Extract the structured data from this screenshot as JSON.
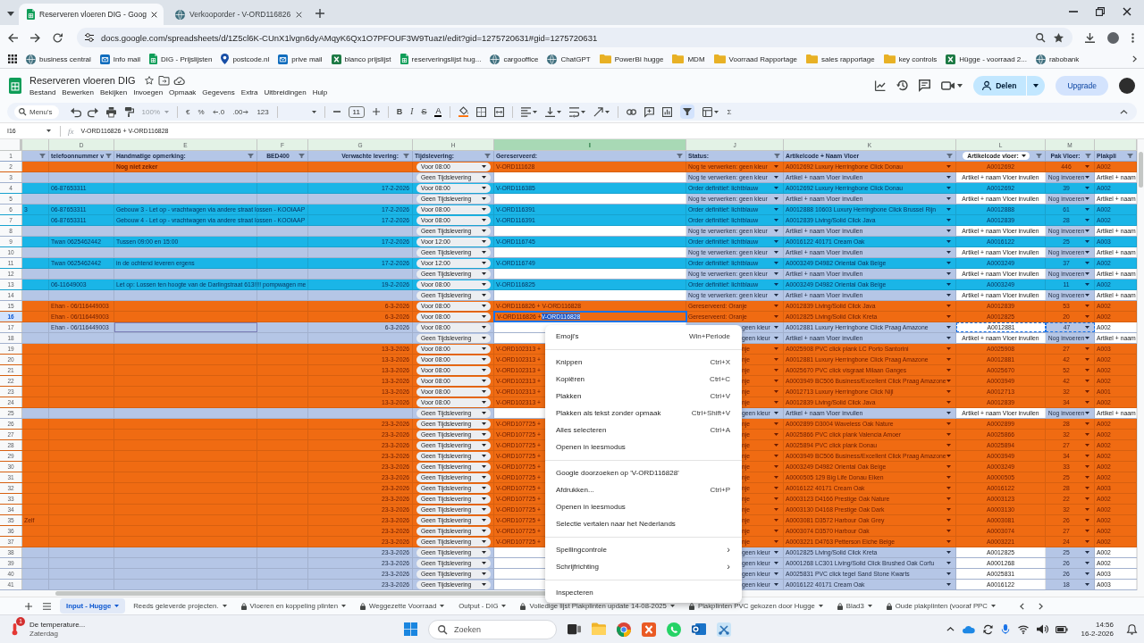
{
  "browser": {
    "tabs": [
      {
        "title": "Reserveren vloeren DIG - Goog",
        "kind": "sheets",
        "selected": true
      },
      {
        "title": "Verkooporder - V-ORD116826",
        "kind": "site",
        "selected": false
      }
    ],
    "url": "docs.google.com/spreadsheets/d/1Z5cl6K-CUnX1lvgn6dyAMqyK6Qx1O7PFOUF3W9TuazI/edit?gid=1275720631#gid=1275720631",
    "bookmarks": [
      {
        "label": "business central",
        "kind": "site"
      },
      {
        "label": "Info mail",
        "kind": "mail"
      },
      {
        "label": "DIG - Prijslijsten",
        "kind": "sheets"
      },
      {
        "label": "postcode.nl",
        "kind": "pin"
      },
      {
        "label": "prive mail",
        "kind": "mail"
      },
      {
        "label": "blanco prijslijst",
        "kind": "excel"
      },
      {
        "label": "reserveringslijst hug...",
        "kind": "sheets"
      },
      {
        "label": "cargooffice",
        "kind": "site"
      },
      {
        "label": "ChatGPT",
        "kind": "site"
      },
      {
        "label": "PowerBI hugge",
        "kind": "folder"
      },
      {
        "label": "MDM",
        "kind": "folder"
      },
      {
        "label": "Voorraad Rapportage",
        "kind": "folder"
      },
      {
        "label": "sales rapportage",
        "kind": "folder"
      },
      {
        "label": "key controls",
        "kind": "folder"
      },
      {
        "label": "Hügge - voorraad 2...",
        "kind": "excel"
      },
      {
        "label": "rabobank",
        "kind": "site"
      }
    ]
  },
  "document": {
    "title": "Reserveren vloeren DIG",
    "menus": [
      "Bestand",
      "Bewerken",
      "Bekijken",
      "Invoegen",
      "Opmaak",
      "Gegevens",
      "Extra",
      "Uitbreidingen",
      "Hulp"
    ],
    "share": "Delen",
    "upgrade": "Upgrade"
  },
  "toolbar": {
    "search": {
      "placeholder": "Menu's"
    },
    "zoom": {
      "value": "100%",
      "disabled": true
    },
    "currency": "€",
    "percent": "%",
    "decimals_less": ".0",
    "decimals_more": ".00",
    "number_format": "123",
    "font_size": "11",
    "bold": "B",
    "italic": "I",
    "strikethrough": "S",
    "text_color": "A",
    "functions": "Σ",
    "filter_on": true
  },
  "formula_bar": {
    "cell": "I16",
    "function_label": "fx",
    "formula": "V-ORD116826 + V-ORD116828"
  },
  "sheet": {
    "header_row": "1",
    "columns": [
      {
        "kind": "text",
        "selected": false
      },
      {
        "letter": "D",
        "header": {
          "text": "telefoonnummer v",
          "kind": "text"
        },
        "kind": "text",
        "selected": false
      },
      {
        "letter": "E",
        "header": {
          "text": "Handmatige opmerking:",
          "kind": "text"
        },
        "kind": "text",
        "selected": false
      },
      {
        "letter": "F",
        "header": {
          "text": "BED400",
          "kind": "text"
        },
        "kind": "text",
        "selected": false
      },
      {
        "letter": "G",
        "header": {
          "text": "Verwachte levering:",
          "kind": "text"
        },
        "kind": "text",
        "selected": false
      },
      {
        "letter": "H",
        "header": {
          "text": "Tijdslevering:",
          "kind": "text"
        },
        "kind": "chip",
        "selected": false
      },
      {
        "letter": "I",
        "header": {
          "text": "Gereserveerd:",
          "kind": "text"
        },
        "kind": "text",
        "selected": true
      },
      {
        "letter": "J",
        "header": {
          "text": "Status:",
          "kind": "text"
        },
        "kind": "dropdown",
        "selected": false
      },
      {
        "letter": "K",
        "header": {
          "text": "Artikelcode + Naam Vloer",
          "kind": "text"
        },
        "kind": "dropdown",
        "selected": false
      },
      {
        "letter": "L",
        "header": {
          "text": "Artikelcode vloer:",
          "kind": "chip"
        },
        "kind": "text",
        "selected": false
      },
      {
        "letter": "M",
        "header": {
          "text": "Pak Vloer:",
          "kind": "text"
        },
        "kind": "dropdown",
        "selected": false
      },
      {
        "header": {
          "text": "Plakpli",
          "kind": "text"
        },
        "kind": "text",
        "selected": false
      }
    ],
    "rows": [
      {
        "row": "2",
        "kind": "reserved",
        "selected": false,
        "cells": [
          null,
          null,
          {
            "text": "Nog niet zeker",
            "kind": "bold"
          },
          null,
          null,
          "Voor 08:00",
          "V-ORD111628",
          "Nog te verwerken: geen kleur",
          "A0012692 Luxury Herringbone Click Donau",
          "A0012692",
          "446",
          "A002"
        ]
      },
      {
        "row": "3",
        "kind": "open",
        "selected": false,
        "cells": [
          null,
          null,
          null,
          null,
          null,
          "Geen Tijdslevering",
          null,
          "Nog te verwerken: geen kleur",
          "Artikel + naam Vloer invullen",
          "Artikel + naam Vloer invullen",
          "Nog invoeren",
          "Artikel + naam"
        ]
      },
      {
        "row": "4",
        "kind": "confirmed",
        "selected": false,
        "cells": [
          null,
          "06-87653311",
          null,
          null,
          "17-2-2026",
          "Voor 08:00",
          "V-ORD116385",
          "Order definitief: lichtblauw",
          "A0012692 Luxury Herringbone Click Donau",
          "A0012692",
          "39",
          "A002"
        ]
      },
      {
        "row": "5",
        "kind": "open",
        "selected": false,
        "cells": [
          null,
          null,
          null,
          null,
          null,
          "Geen Tijdslevering",
          null,
          "Nog te verwerken: geen kleur",
          "Artikel + naam Vloer invullen",
          "Artikel + naam Vloer invullen",
          "Nog invoeren",
          "Artikel + naam"
        ]
      },
      {
        "row": "6",
        "kind": "confirmed",
        "selected": false,
        "cells": [
          "3",
          "06-87653311",
          "Gebouw 3 - Let op - vrachtwagen via andere straat lossen - KOOIAAP",
          null,
          "17-2-2026",
          "Voor 08:00",
          "V-ORD116391",
          "Order definitief: lichtblauw",
          "A0012888 10603 Luxury Herringbone Click Brussel Rijn",
          "A0012888",
          "61",
          "A002"
        ]
      },
      {
        "row": "7",
        "kind": "confirmed",
        "selected": false,
        "cells": [
          null,
          "06-87653311",
          "Gebouw 4 - Let op - vrachtwagen via andere straat lossen - KOOIAAP",
          null,
          "17-2-2026",
          "Voor 08:00",
          "V-ORD116391",
          "Order definitief: lichtblauw",
          "A0012839 Living/Solid Click Java",
          "A0012839",
          "28",
          "A002"
        ]
      },
      {
        "row": "8",
        "kind": "open",
        "selected": false,
        "cells": [
          null,
          null,
          null,
          null,
          null,
          "Geen Tijdslevering",
          null,
          "Nog te verwerken: geen kleur",
          "Artikel + naam Vloer invullen",
          "Artikel + naam Vloer invullen",
          "Nog invoeren",
          "Artikel + naam"
        ]
      },
      {
        "row": "9",
        "kind": "confirmed",
        "selected": false,
        "cells": [
          null,
          "Twan 0625462442",
          "Tussen 09:00 en 15:00",
          null,
          "17-2-2026",
          "Voor 12:00",
          "V-ORD116745",
          "Order definitief: lichtblauw",
          "A0016122 40171 Cream Oak",
          "A0016122",
          "25",
          "A003"
        ]
      },
      {
        "row": "10",
        "kind": "open",
        "selected": false,
        "cells": [
          null,
          null,
          null,
          null,
          null,
          "Geen Tijdslevering",
          null,
          "Nog te verwerken: geen kleur",
          "Artikel + naam Vloer invullen",
          "Artikel + naam Vloer invullen",
          "Nog invoeren",
          "Artikel + naam"
        ]
      },
      {
        "row": "11",
        "kind": "confirmed",
        "selected": false,
        "cells": [
          null,
          "Twan 0625462442",
          "in de ochtend leveren ergens",
          null,
          "17-2-2026",
          "Voor 12:00",
          "V-ORD116749",
          "Order definitief: lichtblauw",
          "A0003249 D4982 Oriental Oak Beige",
          "A0003249",
          "37",
          "A002"
        ]
      },
      {
        "row": "12",
        "kind": "open",
        "selected": false,
        "cells": [
          null,
          null,
          null,
          null,
          null,
          "Geen Tijdslevering",
          null,
          "Nog te verwerken: geen kleur",
          "Artikel + naam Vloer invullen",
          "Artikel + naam Vloer invullen",
          "Nog invoeren",
          "Artikel + naam"
        ]
      },
      {
        "row": "13",
        "kind": "confirmed",
        "selected": false,
        "cells": [
          null,
          "06-11649003",
          "Let op: Lossen ten hoogte van de Darlingstraat 613!!!! pompwagen me",
          null,
          "19-2-2026",
          "Voor 08:00",
          "V-ORD116825",
          "Order definitief: lichtblauw",
          "A0003249 D4982 Oriental Oak Beige",
          "A0003249",
          "11",
          "A002"
        ]
      },
      {
        "row": "14",
        "kind": "open",
        "selected": false,
        "cells": [
          null,
          null,
          null,
          null,
          null,
          "Geen Tijdslevering",
          null,
          "Nog te verwerken: geen kleur",
          "Artikel + naam Vloer invullen",
          "Artikel + naam Vloer invullen",
          "Nog invoeren",
          "Artikel + naam"
        ]
      },
      {
        "row": "15",
        "kind": "reserved",
        "selected": false,
        "cells": [
          null,
          "Ehan - 06/116449003",
          null,
          null,
          "6-3-2026",
          "Voor 08:00",
          "V-ORD116826 + V-ORD116828",
          "Gereserveerd: Oranje",
          "A0012839 Living/Solid Click Java",
          "A0012839",
          "53",
          "A002"
        ]
      },
      {
        "row": "16",
        "kind": "reserved",
        "selected": true,
        "cells": [
          null,
          "Ehan - 06/116449003",
          null,
          null,
          "6-3-2026",
          "Voor 08:00",
          {
            "text": "V-ORD116826 + ",
            "selection": "V-ORD116828",
            "kind": "editing"
          },
          "Gereserveerd: Oranje",
          "A0012825 Living/Solid Click Kreta",
          "A0012825",
          "20",
          "A002"
        ]
      },
      {
        "row": "17",
        "kind": "open",
        "selected": false,
        "cells": [
          null,
          "Ehan - 06/116449003",
          {
            "kind": "outlined"
          },
          null,
          "6-3-2026",
          "Voor 08:00",
          null,
          {
            "text": "geen kleur",
            "kind": "covered"
          },
          "A0012881 Luxury Herringbone Click Praag Amazone",
          {
            "text": "A0012881",
            "kind": "copied"
          },
          {
            "text": "47",
            "kind": "copied"
          },
          "A002"
        ]
      },
      {
        "row": "18",
        "kind": "open",
        "selected": false,
        "cells": [
          null,
          null,
          null,
          null,
          null,
          "Geen Tijdslevering",
          null,
          {
            "text": "geen kleur",
            "kind": "covered"
          },
          "Artikel + naam Vloer invullen",
          "Artikel + naam Vloer invullen",
          "Nog invoeren",
          "Artikel + naam"
        ]
      },
      {
        "row": "19",
        "kind": "reserved",
        "selected": false,
        "cells": [
          null,
          null,
          null,
          null,
          "13-3-2026",
          "Voor 08:00",
          "V-ORD102313 +",
          {
            "text": "nje",
            "kind": "covered"
          },
          "A0025908 PVC click plank LC Porto Santorini",
          "A0025908",
          "27",
          "A003"
        ]
      },
      {
        "row": "20",
        "kind": "reserved",
        "selected": false,
        "cells": [
          null,
          null,
          null,
          null,
          "13-3-2026",
          "Voor 08:00",
          "V-ORD102313 +",
          {
            "text": "nje",
            "kind": "covered"
          },
          "A0012881 Luxury Herringbone Click Praag Amazone",
          "A0012881",
          "42",
          "A002"
        ]
      },
      {
        "row": "21",
        "kind": "reserved",
        "selected": false,
        "cells": [
          null,
          null,
          null,
          null,
          "13-3-2026",
          "Voor 08:00",
          "V-ORD102313 +",
          {
            "text": "nje",
            "kind": "covered"
          },
          "A0025670 PVC click visgraat Milaan Ganges",
          "A0025670",
          "52",
          "A002"
        ]
      },
      {
        "row": "22",
        "kind": "reserved",
        "selected": false,
        "cells": [
          null,
          null,
          null,
          null,
          "13-3-2026",
          "Voor 08:00",
          "V-ORD102313 +",
          {
            "text": "nje",
            "kind": "covered"
          },
          "A0003949 BC506 Business/Excellent Click Praag Amazone",
          "A0003949",
          "42",
          "A002"
        ]
      },
      {
        "row": "23",
        "kind": "reserved",
        "selected": false,
        "cells": [
          null,
          null,
          null,
          null,
          "13-3-2026",
          "Voor 08:00",
          "V-ORD102313 +",
          {
            "text": "nje",
            "kind": "covered"
          },
          "A0012713 Luxury Herringbone Click Nijl",
          "A0012713",
          "32",
          "A001"
        ]
      },
      {
        "row": "24",
        "kind": "reserved",
        "selected": false,
        "cells": [
          null,
          null,
          null,
          null,
          "13-3-2026",
          "Voor 08:00",
          "V-ORD102313 +",
          {
            "text": "nje",
            "kind": "covered"
          },
          "A0012839 Living/Solid Click Java",
          "A0012839",
          "34",
          "A002"
        ]
      },
      {
        "row": "25",
        "kind": "open",
        "selected": false,
        "cells": [
          null,
          null,
          null,
          null,
          null,
          "Geen Tijdslevering",
          null,
          {
            "text": "geen kleur",
            "kind": "covered"
          },
          "Artikel + naam Vloer invullen",
          "Artikel + naam Vloer invullen",
          "Nog invoeren",
          "Artikel + naam"
        ]
      },
      {
        "row": "26",
        "kind": "reserved",
        "selected": false,
        "cells": [
          null,
          null,
          null,
          null,
          "23-3-2026",
          "Geen Tijdslevering",
          "V-ORD107725 +",
          {
            "text": "nje",
            "kind": "covered"
          },
          "A0002899 D3004 Waveless Oak Nature",
          "A0002899",
          "28",
          "A002"
        ]
      },
      {
        "row": "27",
        "kind": "reserved",
        "selected": false,
        "cells": [
          null,
          null,
          null,
          null,
          "23-3-2026",
          "Geen Tijdslevering",
          "V-ORD107725 +",
          {
            "text": "nje",
            "kind": "covered"
          },
          "A0025866 PVC click plank Valencia Amoer",
          "A0025866",
          "32",
          "A002"
        ]
      },
      {
        "row": "28",
        "kind": "reserved",
        "selected": false,
        "cells": [
          null,
          null,
          null,
          null,
          "23-3-2026",
          "Geen Tijdslevering",
          "V-ORD107725 +",
          {
            "text": "nje",
            "kind": "covered"
          },
          "A0025894 PVC click plank Donau",
          "A0025894",
          "27",
          "A002"
        ]
      },
      {
        "row": "29",
        "kind": "reserved",
        "selected": false,
        "cells": [
          null,
          null,
          null,
          null,
          "23-3-2026",
          "Geen Tijdslevering",
          "V-ORD107725 +",
          {
            "text": "nje",
            "kind": "covered"
          },
          "A0003949 BC506 Business/Excellent Click Praag Amazone",
          "A0003949",
          "34",
          "A002"
        ]
      },
      {
        "row": "30",
        "kind": "reserved",
        "selected": false,
        "cells": [
          null,
          null,
          null,
          null,
          "23-3-2026",
          "Geen Tijdslevering",
          "V-ORD107725 +",
          {
            "text": "nje",
            "kind": "covered"
          },
          "A0003249 D4982 Oriental Oak Beige",
          "A0003249",
          "33",
          "A002"
        ]
      },
      {
        "row": "31",
        "kind": "reserved",
        "selected": false,
        "cells": [
          null,
          null,
          null,
          null,
          "23-3-2026",
          "Geen Tijdslevering",
          "V-ORD107725 +",
          {
            "text": "nje",
            "kind": "covered"
          },
          "A0000505 129 Big Life Donau Eiken",
          "A0000505",
          "25",
          "A002"
        ]
      },
      {
        "row": "32",
        "kind": "reserved",
        "selected": false,
        "cells": [
          null,
          null,
          null,
          null,
          "23-3-2026",
          "Geen Tijdslevering",
          "V-ORD107725 +",
          {
            "text": "nje",
            "kind": "covered"
          },
          "A0016122 40171 Cream Oak",
          "A0016122",
          "28",
          "A003"
        ]
      },
      {
        "row": "33",
        "kind": "reserved",
        "selected": false,
        "cells": [
          null,
          null,
          null,
          null,
          "23-3-2026",
          "Geen Tijdslevering",
          "V-ORD107725 +",
          {
            "text": "nje",
            "kind": "covered"
          },
          "A0003123 D4166 Prestige Oak Nature",
          "A0003123",
          "22",
          "A002"
        ]
      },
      {
        "row": "34",
        "kind": "reserved",
        "selected": false,
        "cells": [
          null,
          null,
          null,
          null,
          "23-3-2026",
          "Geen Tijdslevering",
          "V-ORD107725 +",
          {
            "text": "nje",
            "kind": "covered"
          },
          "A0003130 D4168 Prestige Oak Dark",
          "A0003130",
          "32",
          "A002"
        ]
      },
      {
        "row": "35",
        "kind": "reserved",
        "selected": false,
        "cells": [
          "Zelf",
          null,
          null,
          null,
          "23-3-2026",
          "Geen Tijdslevering",
          "V-ORD107725 +",
          {
            "text": "nje",
            "kind": "covered"
          },
          "A0003081 D3572 Harbour Oak Grey",
          "A0003081",
          "26",
          "A002"
        ]
      },
      {
        "row": "36",
        "kind": "reserved",
        "selected": false,
        "cells": [
          null,
          null,
          null,
          null,
          "23-3-2026",
          "Geen Tijdslevering",
          "V-ORD107725 +",
          {
            "text": "nje",
            "kind": "covered"
          },
          "A0003074 D3570 Harbour Oak",
          "A0003074",
          "27",
          "A002"
        ]
      },
      {
        "row": "37",
        "kind": "reserved",
        "selected": false,
        "cells": [
          null,
          null,
          null,
          null,
          "23-3-2026",
          "Geen Tijdslevering",
          "V-ORD107725 +",
          {
            "text": "nje",
            "kind": "covered"
          },
          "A0003221 D4763 Petterson Eiche Beige",
          "A0003221",
          "24",
          "A002"
        ]
      },
      {
        "row": "38",
        "kind": "open",
        "selected": false,
        "cells": [
          null,
          null,
          null,
          null,
          "23-3-2026",
          "Geen Tijdslevering",
          null,
          {
            "text": "geen kleur",
            "kind": "covered"
          },
          "A0012825 Living/Solid Click Kreta",
          "A0012825",
          "25",
          "A002"
        ]
      },
      {
        "row": "39",
        "kind": "open",
        "selected": false,
        "cells": [
          null,
          null,
          null,
          null,
          "23-3-2026",
          "Geen Tijdslevering",
          null,
          {
            "text": "geen kleur",
            "kind": "covered"
          },
          "A0001268 LC301 Living/Solid Click Brushed Oak Corfu",
          "A0001268",
          "26",
          "A002"
        ]
      },
      {
        "row": "40",
        "kind": "open",
        "selected": false,
        "cells": [
          null,
          null,
          null,
          null,
          "23-3-2026",
          "Geen Tijdslevering",
          null,
          {
            "text": "geen kleur",
            "kind": "covered"
          },
          "A0025831 PVC click tegel Sand Stone Kwarts",
          "A0025831",
          "26",
          "A003"
        ]
      },
      {
        "row": "41",
        "kind": "open",
        "selected": false,
        "cells": [
          null,
          null,
          null,
          null,
          "23-3-2026",
          "Geen Tijdslevering",
          null,
          {
            "text": "geen kleur",
            "kind": "covered"
          },
          "A0016122 40171 Cream Oak",
          "A0016122",
          "18",
          "A003"
        ]
      }
    ]
  },
  "context_menu": {
    "groups": [
      [
        {
          "label": "Emoji's",
          "shortcut": "Win+Periode"
        }
      ],
      [
        {
          "label": "Knippen",
          "shortcut": "Ctrl+X"
        },
        {
          "label": "Kopiëren",
          "shortcut": "Ctrl+C"
        },
        {
          "label": "Plakken",
          "shortcut": "Ctrl+V"
        },
        {
          "label": "Plakken als tekst zonder opmaak",
          "shortcut": "Ctrl+Shift+V"
        },
        {
          "label": "Alles selecteren",
          "shortcut": "Ctrl+A"
        },
        {
          "label": "Openen in leesmodus"
        }
      ],
      [
        {
          "label": "Google doorzoeken op 'V-ORD116828'"
        },
        {
          "label": "Afdrukken...",
          "shortcut": "Ctrl+P"
        },
        {
          "label": "Openen in leesmodus"
        },
        {
          "label": "Selectie vertalen naar het Nederlands"
        }
      ],
      [
        {
          "label": "Spellingcontrole",
          "arrow": "›"
        },
        {
          "label": "Schrijfrichting",
          "arrow": "›"
        }
      ],
      [
        {
          "label": "Inspecteren"
        }
      ]
    ]
  },
  "sheet_tabs": [
    {
      "label": "Input - Hugge",
      "selected": true,
      "locked": false
    },
    {
      "label": "Reeds geleverde projecten.",
      "selected": false,
      "locked": false
    },
    {
      "label": "Vloeren en koppeling plinten",
      "selected": false,
      "locked": true
    },
    {
      "label": "Weggezette Voorraad",
      "selected": false,
      "locked": true
    },
    {
      "label": "Output - DIG",
      "selected": false,
      "locked": false
    },
    {
      "label": "Volledige lijst Plakplinten update 14-08-2025",
      "selected": false,
      "locked": true
    },
    {
      "label": "Plakplinten PVC gekozen door Hugge",
      "selected": false,
      "locked": true
    },
    {
      "label": "Blad3",
      "selected": false,
      "locked": true
    },
    {
      "label": "Oude plakplinten (vooraf PPC",
      "selected": false,
      "locked": true
    }
  ],
  "taskbar": {
    "weather": {
      "title": "De temperature...",
      "subtitle": "Zaterdag",
      "badge": "1"
    },
    "search": {
      "placeholder": "Zoeken"
    },
    "time": "14:56",
    "date": "16-2-2026"
  }
}
